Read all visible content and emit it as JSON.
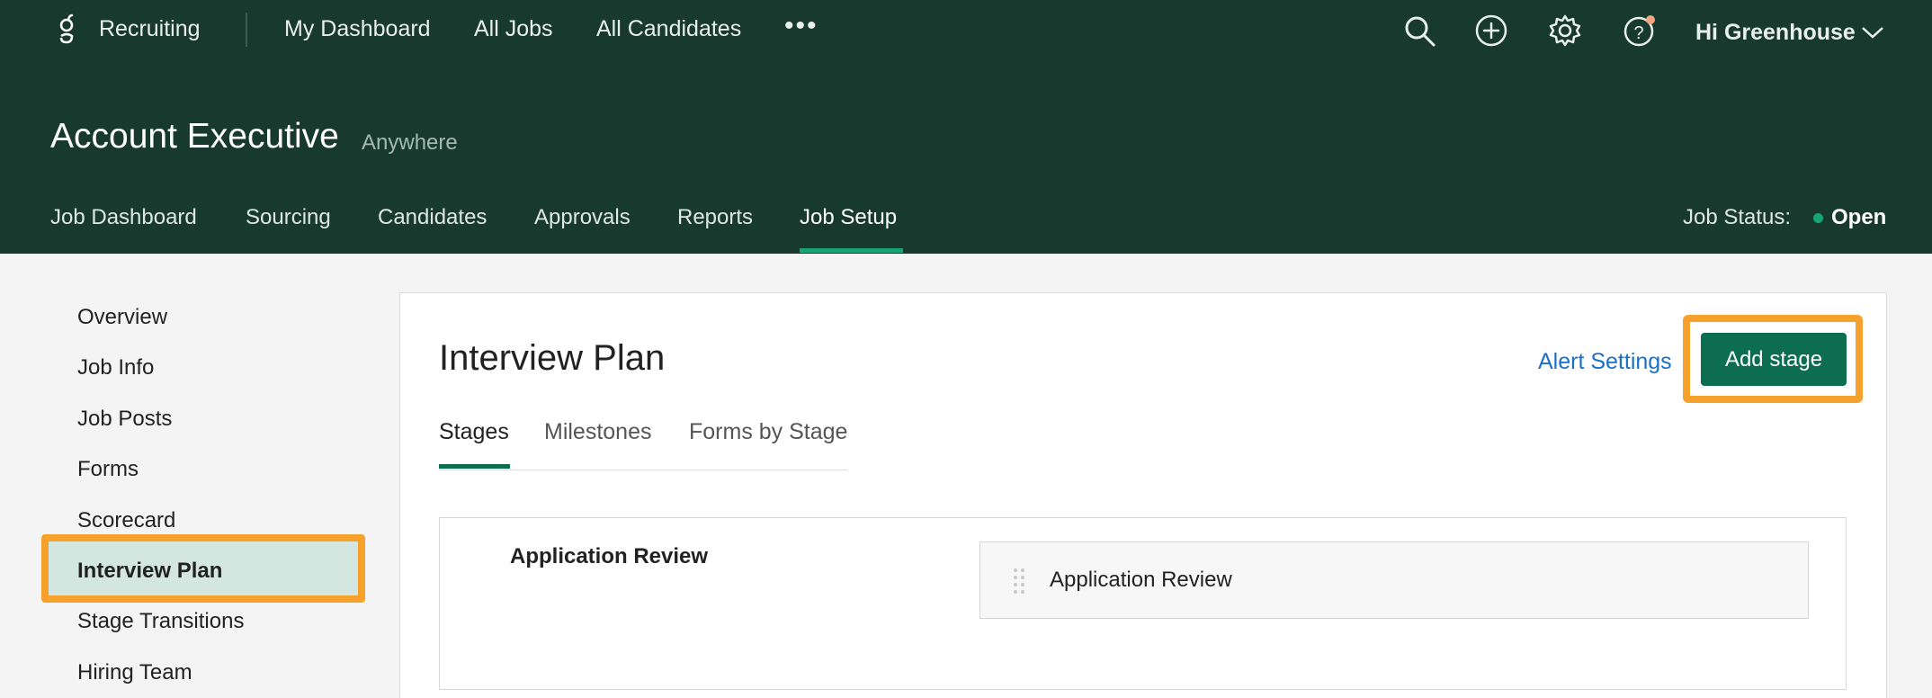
{
  "app": {
    "brand": "Recruiting",
    "logo_icon": "greenhouse-g-logo",
    "nav": [
      "My Dashboard",
      "All Jobs",
      "All Candidates"
    ],
    "more": "•••",
    "icons": [
      "search-icon",
      "add-circle-icon",
      "gear-icon",
      "help-icon"
    ],
    "greeting": "Hi Greenhouse"
  },
  "job": {
    "title": "Account Executive",
    "location": "Anywhere",
    "tabs": [
      "Job Dashboard",
      "Sourcing",
      "Candidates",
      "Approvals",
      "Reports",
      "Job Setup"
    ],
    "active_tab": "Job Setup",
    "status_label": "Job Status:",
    "status_value": "Open"
  },
  "sidebar": {
    "items": [
      "Overview",
      "Job Info",
      "Job Posts",
      "Forms",
      "Scorecard",
      "Interview Plan",
      "Stage Transitions",
      "Hiring Team"
    ],
    "active": "Interview Plan"
  },
  "main": {
    "title": "Interview Plan",
    "alert_link": "Alert Settings",
    "add_button": "Add stage",
    "tabs": [
      "Stages",
      "Milestones",
      "Forms by Stage"
    ],
    "active_tab": "Stages",
    "stages": [
      {
        "name": "Application Review",
        "items": [
          "Application Review"
        ]
      }
    ]
  },
  "colors": {
    "header_bg": "#183a2e",
    "accent_green": "#17a673",
    "button_green": "#0d6e4f",
    "highlight_orange": "#f7a12d",
    "link_blue": "#1a6fc9",
    "notification_dot": "#f4a582"
  }
}
